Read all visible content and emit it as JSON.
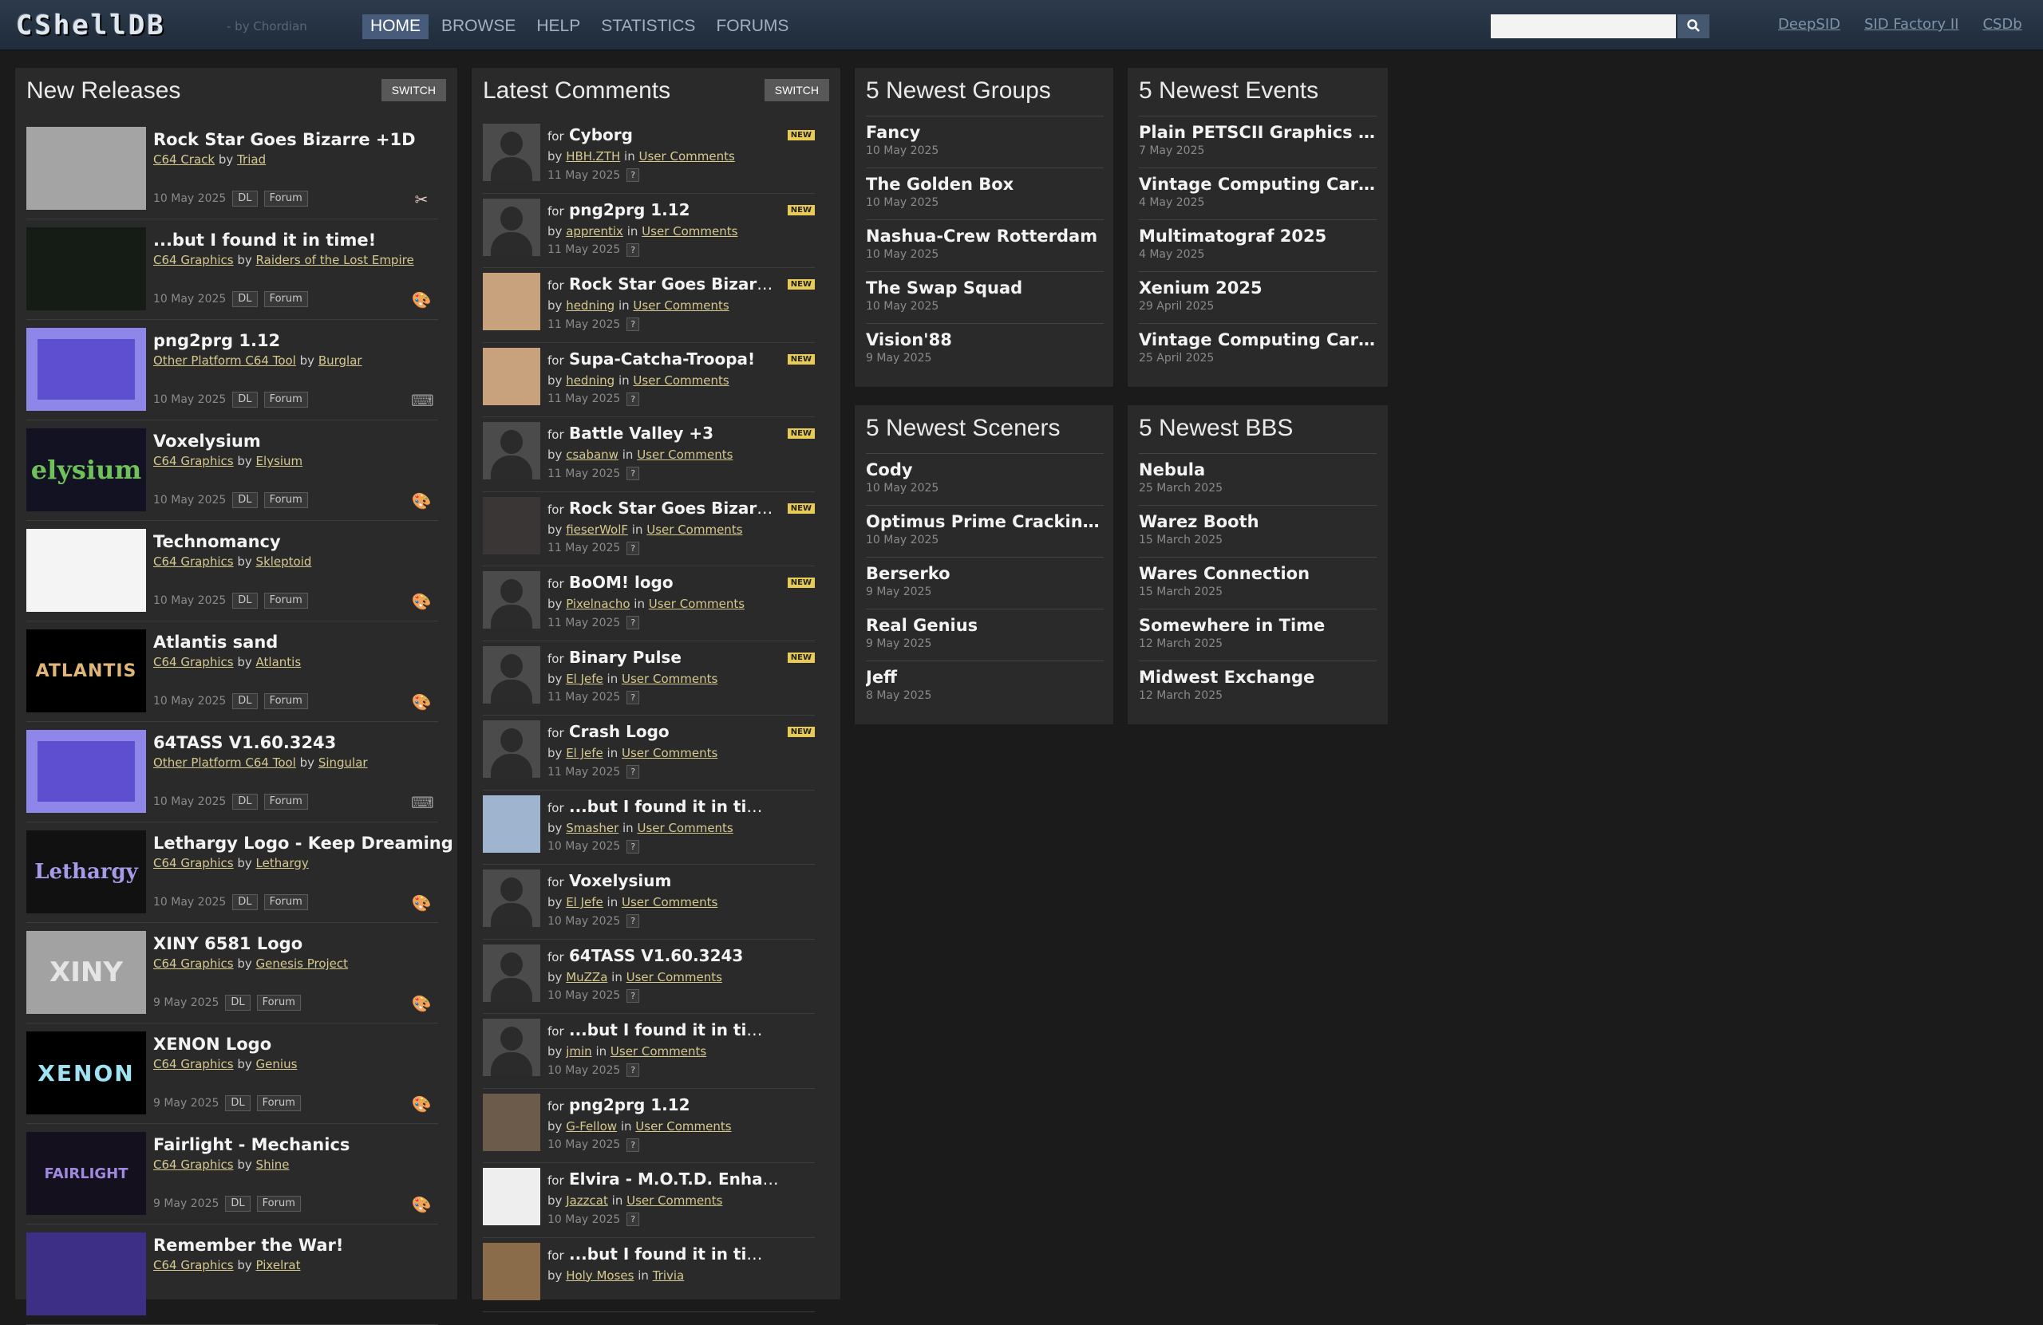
{
  "header": {
    "logo": "CShellDB",
    "byline": "- by Chordian",
    "nav": [
      "HOME",
      "BROWSE",
      "HELP",
      "STATISTICS",
      "FORUMS"
    ],
    "external_links": [
      "DeepSID",
      "SID Factory II",
      "CSDb"
    ]
  },
  "releases": {
    "title": "New Releases",
    "switch_label": "SWITCH",
    "dl_label": "DL",
    "forum_label": "Forum",
    "items": [
      {
        "title": "Rock Star Goes Bizarre +1D",
        "category": "C64 Crack",
        "by_word": "by",
        "group": "Triad",
        "date": "10 May 2025",
        "icon": "crack-icon"
      },
      {
        "title": "...but I found it in time!",
        "category": "C64 Graphics",
        "by_word": "by",
        "group": "Raiders of the Lost Empire",
        "date": "10 May 2025",
        "icon": "palette-icon"
      },
      {
        "title": "png2prg 1.12",
        "category": "Other Platform C64 Tool",
        "by_word": "by",
        "group": "Burglar",
        "date": "10 May 2025",
        "icon": "keyboard-icon"
      },
      {
        "title": "Voxelysium",
        "category": "C64 Graphics",
        "by_word": "by",
        "group": "Elysium",
        "date": "10 May 2025",
        "icon": "palette-icon"
      },
      {
        "title": "Technomancy",
        "category": "C64 Graphics",
        "by_word": "by",
        "group": "Skleptoid",
        "date": "10 May 2025",
        "icon": "palette-icon"
      },
      {
        "title": "Atlantis sand",
        "category": "C64 Graphics",
        "by_word": "by",
        "group": "Atlantis",
        "date": "10 May 2025",
        "icon": "palette-icon"
      },
      {
        "title": "64TASS V1.60.3243",
        "category": "Other Platform C64 Tool",
        "by_word": "by",
        "group": "Singular",
        "date": "10 May 2025",
        "icon": "keyboard-icon"
      },
      {
        "title": "Lethargy Logo - Keep Dreaming",
        "category": "C64 Graphics",
        "by_word": "by",
        "group": "Lethargy",
        "date": "10 May 2025",
        "icon": "palette-icon"
      },
      {
        "title": "XINY 6581 Logo",
        "category": "C64 Graphics",
        "by_word": "by",
        "group": "Genesis Project",
        "date": "9 May 2025",
        "icon": "palette-icon"
      },
      {
        "title": "XENON Logo",
        "category": "C64 Graphics",
        "by_word": "by",
        "group": "Genius",
        "date": "9 May 2025",
        "icon": "palette-icon"
      },
      {
        "title": "Fairlight - Mechanics",
        "category": "C64 Graphics",
        "by_word": "by",
        "group": "Shine",
        "date": "9 May 2025",
        "icon": "palette-icon"
      },
      {
        "title": "Remember the War!",
        "category": "C64 Graphics",
        "by_word": "by",
        "group": "Pixelrat",
        "date": "",
        "icon": "palette-icon"
      }
    ]
  },
  "thumb_texts": [
    "",
    "",
    "",
    "elysium",
    "",
    "ATLANTIS",
    "",
    "Lethargy",
    "XINY",
    "XENON",
    "FAIRLIGHT",
    ""
  ],
  "comments": {
    "title": "Latest Comments",
    "switch_label": "SWITCH",
    "for_word": "for",
    "by_word": "by",
    "in_word": "in",
    "new_label": "NEW",
    "q_label": "?",
    "items": [
      {
        "target": "Cyborg",
        "user": "HBH.ZTH",
        "where": "User Comments",
        "date": "11 May 2025",
        "new": true
      },
      {
        "target": "png2prg 1.12",
        "user": "apprentix",
        "where": "User Comments",
        "date": "11 May 2025",
        "new": true
      },
      {
        "target": "Rock Star Goes Bizarre +...",
        "user": "hedning",
        "where": "User Comments",
        "date": "11 May 2025",
        "new": true
      },
      {
        "target": "Supa-Catcha-Troopa!",
        "user": "hedning",
        "where": "User Comments",
        "date": "11 May 2025",
        "new": true
      },
      {
        "target": "Battle Valley +3",
        "user": "csabanw",
        "where": "User Comments",
        "date": "11 May 2025",
        "new": true
      },
      {
        "target": "Rock Star Goes Bizarre +...",
        "user": "fieserWolF",
        "where": "User Comments",
        "date": "11 May 2025",
        "new": true
      },
      {
        "target": "BoOM! logo",
        "user": "Pixelnacho",
        "where": "User Comments",
        "date": "11 May 2025",
        "new": true
      },
      {
        "target": "Binary Pulse",
        "user": "El Jefe",
        "where": "User Comments",
        "date": "11 May 2025",
        "new": true
      },
      {
        "target": "Crash Logo",
        "user": "El Jefe",
        "where": "User Comments",
        "date": "11 May 2025",
        "new": true
      },
      {
        "target": "...but I found it in time!",
        "user": "Smasher",
        "where": "User Comments",
        "date": "10 May 2025",
        "new": false
      },
      {
        "target": "Voxelysium",
        "user": "El Jefe",
        "where": "User Comments",
        "date": "10 May 2025",
        "new": false
      },
      {
        "target": "64TASS V1.60.3243",
        "user": "MuZZa",
        "where": "User Comments",
        "date": "10 May 2025",
        "new": false
      },
      {
        "target": "...but I found it in time!",
        "user": "jmin",
        "where": "User Comments",
        "date": "10 May 2025",
        "new": false
      },
      {
        "target": "png2prg 1.12",
        "user": "G-Fellow",
        "where": "User Comments",
        "date": "10 May 2025",
        "new": false
      },
      {
        "target": "Elvira - M.O.T.D. Enhanced +...",
        "user": "Jazzcat",
        "where": "User Comments",
        "date": "10 May 2025",
        "new": false
      },
      {
        "target": "...but I found it in time!",
        "user": "Holy Moses",
        "where": "Trivia",
        "date": "",
        "new": false
      }
    ]
  },
  "groups": {
    "title": "5 Newest Groups",
    "items": [
      {
        "name": "Fancy",
        "date": "10 May 2025"
      },
      {
        "name": "The Golden Box",
        "date": "10 May 2025"
      },
      {
        "name": "Nashua-Crew Rotterdam",
        "date": "10 May 2025"
      },
      {
        "name": "The Swap Squad",
        "date": "10 May 2025"
      },
      {
        "name": "Vision'88",
        "date": "9 May 2025"
      }
    ]
  },
  "events": {
    "title": "5 Newest Events",
    "items": [
      {
        "name": "Plain PETSCII Graphics Com...",
        "date": "7 May 2025"
      },
      {
        "name": "Vintage Computing Carint...",
        "date": "4 May 2025"
      },
      {
        "name": "Multimatograf 2025",
        "date": "4 May 2025"
      },
      {
        "name": "Xenium 2025",
        "date": "29 April 2025"
      },
      {
        "name": "Vintage Computing Carint...",
        "date": "25 April 2025"
      }
    ]
  },
  "sceners": {
    "title": "5 Newest Sceners",
    "items": [
      {
        "name": "Cody",
        "date": "10 May 2025"
      },
      {
        "name": "Optimus Prime Crackings",
        "date": "10 May 2025"
      },
      {
        "name": "Berserko",
        "date": "9 May 2025"
      },
      {
        "name": "Real Genius",
        "date": "9 May 2025"
      },
      {
        "name": "Jeff",
        "date": "8 May 2025"
      }
    ]
  },
  "bbs": {
    "title": "5 Newest BBS",
    "items": [
      {
        "name": "Nebula",
        "date": "25 March 2025"
      },
      {
        "name": "Warez Booth",
        "date": "15 March 2025"
      },
      {
        "name": "Wares Connection",
        "date": "15 March 2025"
      },
      {
        "name": "Somewhere in Time",
        "date": "12 March 2025"
      },
      {
        "name": "Midwest Exchange",
        "date": "12 March 2025"
      }
    ]
  }
}
